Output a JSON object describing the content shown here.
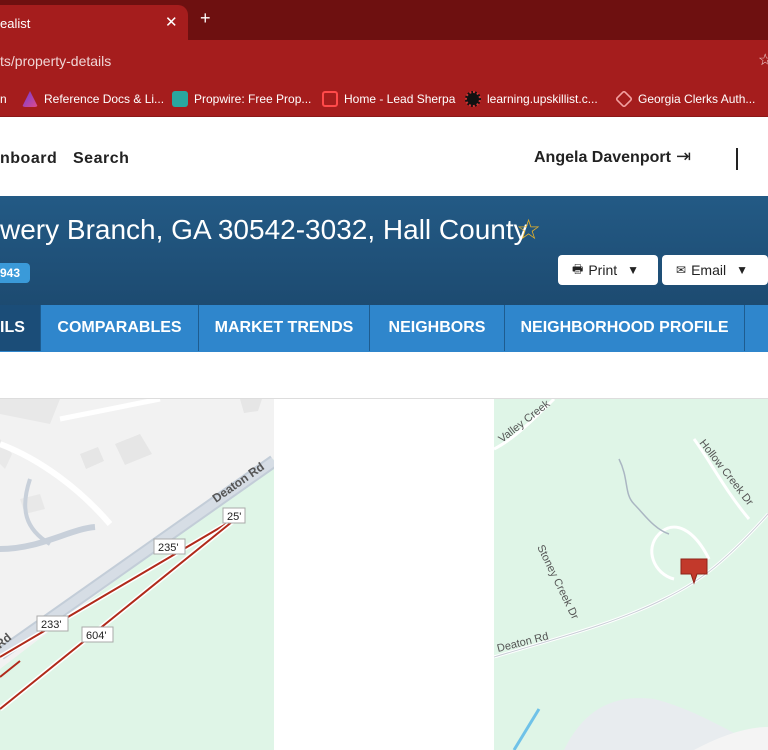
{
  "browser": {
    "tab_title": "ealist",
    "tab_close": "✕",
    "new_tab": "+",
    "url": "ts/property-details",
    "bookmarks": [
      {
        "label": "n",
        "icon": "bookmark-icon"
      },
      {
        "label": "Reference Docs & Li...",
        "icon": "docs-icon"
      },
      {
        "label": "Propwire: Free Prop...",
        "icon": "propwire-icon"
      },
      {
        "label": "Home - Lead Sherpa",
        "icon": "lead-sherpa-icon"
      },
      {
        "label": "learning.upskillist.c...",
        "icon": "upskillist-icon"
      },
      {
        "label": "Georgia Clerks Auth...",
        "icon": "georgia-clerks-icon"
      }
    ]
  },
  "header": {
    "nav_dashboard": "nboard",
    "nav_search": "Search",
    "user_name": "Angela Davenport",
    "logout_icon": "⇥"
  },
  "property": {
    "address": "wery Branch, GA 30542-3032, Hall County",
    "id_badge": "943",
    "print_label": "Print",
    "email_label": "Email"
  },
  "tabs": [
    {
      "label": "ILS"
    },
    {
      "label": "COMPARABLES"
    },
    {
      "label": "MARKET TRENDS"
    },
    {
      "label": "NEIGHBORS"
    },
    {
      "label": "NEIGHBORHOOD PROFILE"
    }
  ],
  "map_parcel": {
    "road_label": "Deaton Rd",
    "road_label_partial": "Rd",
    "dimensions": [
      "25'",
      "235'",
      "233'",
      "604'"
    ]
  },
  "map_locator": {
    "streets": [
      "Valley Creek",
      "Hollow Creek Dr",
      "Stoney Creek Dr",
      "Deaton Rd"
    ],
    "marker_icon": "location-marker-icon"
  },
  "colors": {
    "chrome_dark": "#6e1010",
    "chrome": "#a51d1d",
    "banner": "#1f4f78",
    "tab_bar": "#2f86cc",
    "tab_active": "#1b4d78",
    "parcel_line": "#b02a1a",
    "map_green": "#dff5e7",
    "star": "#e7b22a"
  }
}
